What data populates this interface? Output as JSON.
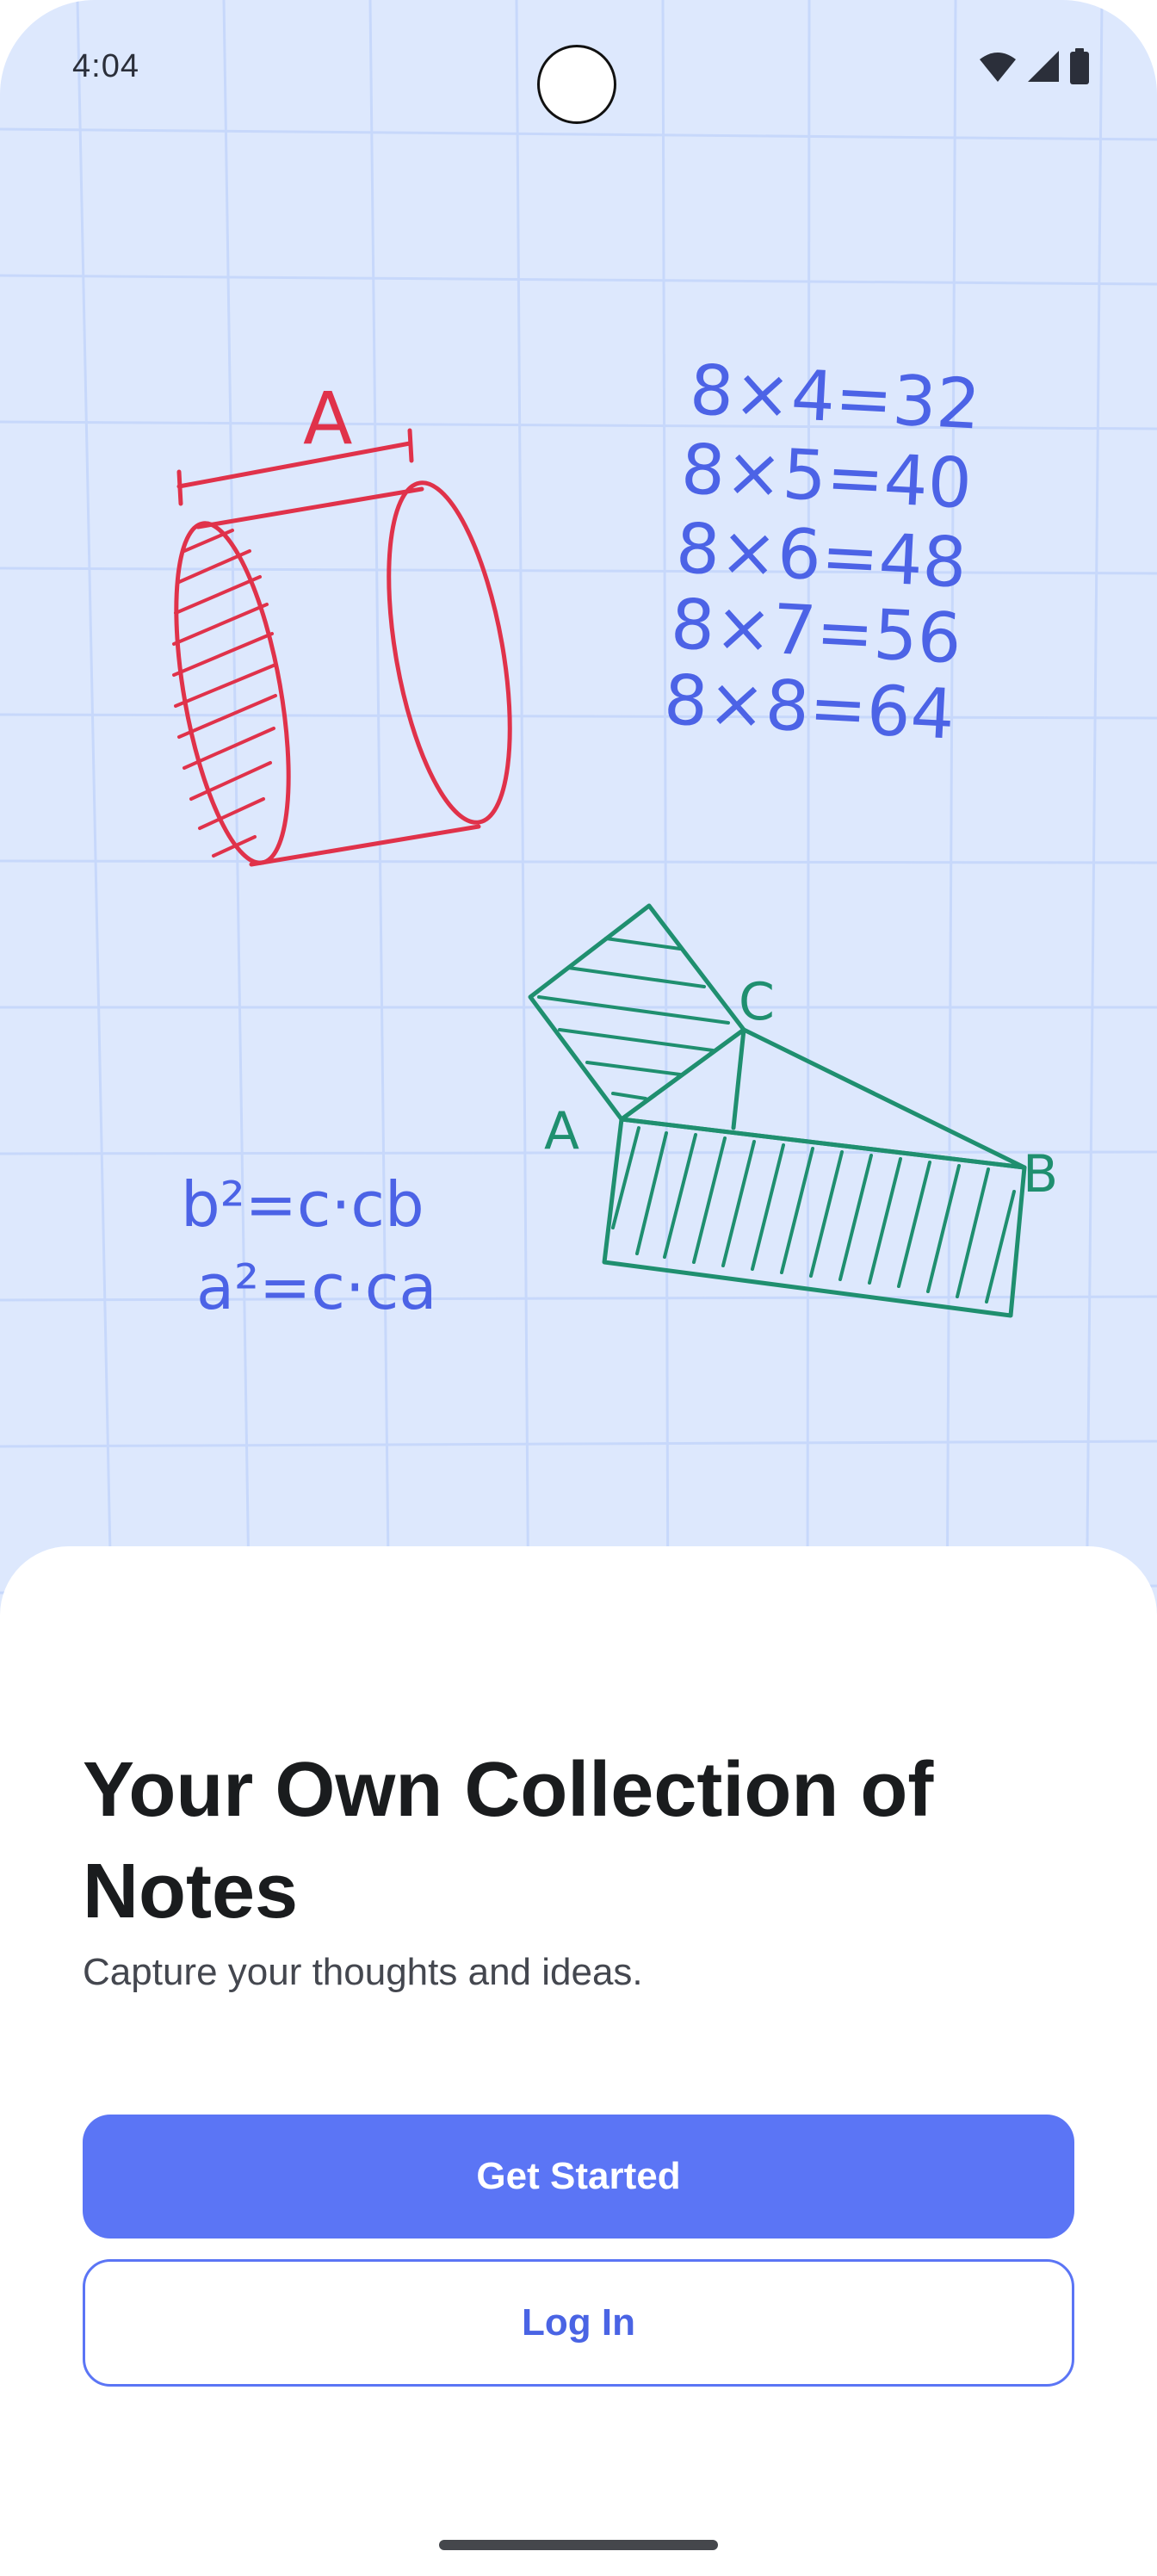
{
  "status_bar": {
    "time": "4:04",
    "icons": [
      "wifi-icon",
      "signal-icon",
      "battery-icon"
    ]
  },
  "illustration": {
    "cylinder_label": "A",
    "multiplication": [
      "8×4=32",
      "8×5=40",
      "8×6=48",
      "8×7=56",
      "8×8=64"
    ],
    "formulas": [
      "b²=c·cb",
      "a²=c·ca"
    ],
    "triangle_labels": {
      "a": "A",
      "b": "B",
      "c": "C"
    }
  },
  "onboarding": {
    "title": "Your Own Collection of Notes",
    "subtitle": "Capture your thoughts and ideas.",
    "primary_button": "Get Started",
    "secondary_button": "Log In"
  },
  "colors": {
    "hero_background": "#dde8fd",
    "grid_line": "#c7d8fb",
    "red_ink": "#e0324a",
    "blue_ink": "#4c63e6",
    "green_ink": "#1f8f6f",
    "primary": "#5b75f5"
  }
}
